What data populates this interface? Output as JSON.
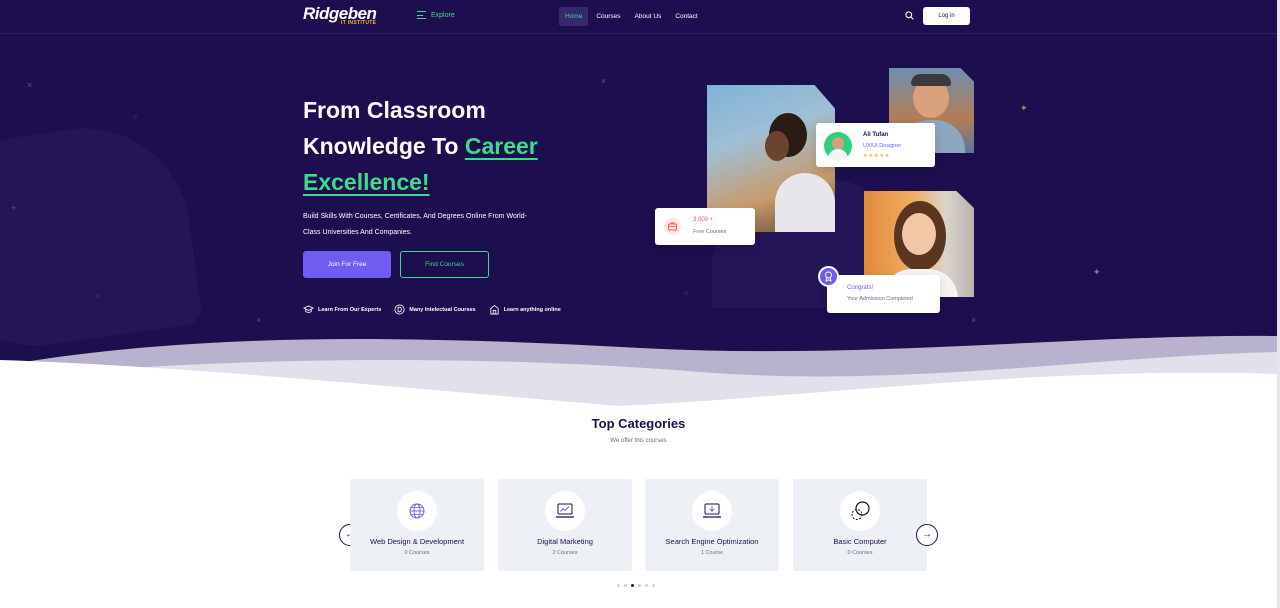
{
  "brand": {
    "name": "Ridgeben",
    "tagline": "IT INSTITUTE"
  },
  "nav": {
    "explore_label": "Explore",
    "links": [
      {
        "label": "Home",
        "active": true
      },
      {
        "label": "Courses",
        "active": false
      },
      {
        "label": "About Us",
        "active": false
      },
      {
        "label": "Contact",
        "active": false
      }
    ],
    "login_label": "Log in"
  },
  "hero": {
    "title_line1": "From Classroom",
    "title_line2_plain": "Knowledge To ",
    "title_line2_accent": "Career",
    "title_line3_accent": "Excellence!",
    "description": "Build Skills With Courses, Certificates, And Degrees Online From World-Class Universities And Companies.",
    "join_label": "Join For Free",
    "find_label": "Find Courses",
    "features": [
      {
        "label": "Learn From Our Experts",
        "icon": "graduation-cap-icon"
      },
      {
        "label": "Many Intelectual Courses",
        "icon": "d-badge-icon"
      },
      {
        "label": "Learn anything online",
        "icon": "building-icon"
      }
    ],
    "profile_card": {
      "name": "Ali Tufan",
      "role": "UX/UI Designer",
      "stars": "★★★★★"
    },
    "courses_card": {
      "count": "3,000 +",
      "label": "Free Courses"
    },
    "congrats_card": {
      "title": "Congrats!",
      "subtitle": "Your Admission Completed"
    }
  },
  "categories": {
    "title": "Top Categories",
    "subtitle": "We offer this courses",
    "items": [
      {
        "name": "Web Design & Development",
        "count": "0 Courses",
        "icon": "globe-code-icon"
      },
      {
        "name": "Digital Marketing",
        "count": "2 Courses",
        "icon": "laptop-chart-icon"
      },
      {
        "name": "Search Engine Optimization",
        "count": "1 Course",
        "icon": "laptop-download-icon"
      },
      {
        "name": "Basic Computer",
        "count": "0 Courses",
        "icon": "circles-icon"
      }
    ],
    "prev_label": "←",
    "next_label": "→",
    "dots": 6,
    "active_dot": 2
  },
  "colors": {
    "hero_bg": "#1d0e4f",
    "accent_green": "#3bdc8a",
    "accent_purple": "#6f5cf0",
    "accent_red": "#f0594b",
    "star": "#f3b531"
  }
}
